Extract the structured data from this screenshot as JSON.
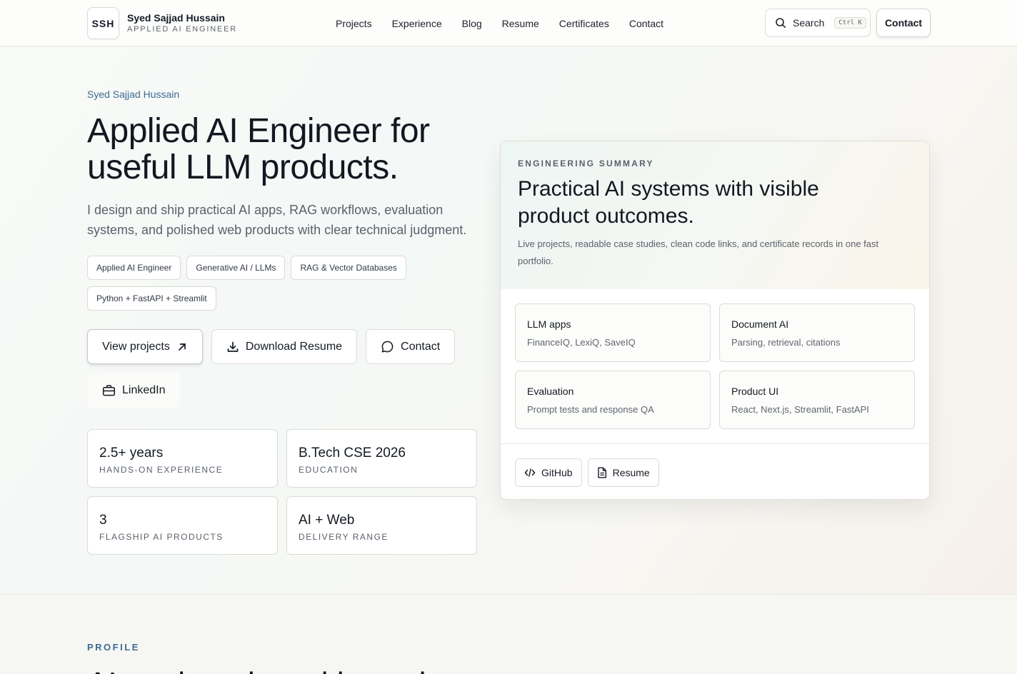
{
  "header": {
    "logo_text": "SSH",
    "name": "Syed Sajjad Hussain",
    "role": "APPLIED AI ENGINEER",
    "nav": [
      "Projects",
      "Experience",
      "Blog",
      "Resume",
      "Certificates",
      "Contact"
    ],
    "search_label": "Search",
    "search_shortcut": "Ctrl K",
    "contact_label": "Contact"
  },
  "hero": {
    "eyebrow": "Syed Sajjad Hussain",
    "title": "Applied AI Engineer for useful LLM products.",
    "subtitle": "I design and ship practical AI apps, RAG workflows, evaluation systems, and polished web products with clear technical judgment.",
    "chips": [
      "Applied AI Engineer",
      "Generative AI / LLMs",
      "RAG & Vector Databases",
      "Python + FastAPI + Streamlit"
    ],
    "actions": {
      "view_projects": "View projects",
      "download_resume": "Download Resume",
      "contact": "Contact",
      "linkedin": "LinkedIn"
    },
    "stats": [
      {
        "value": "2.5+ years",
        "label": "HANDS-ON EXPERIENCE"
      },
      {
        "value": "B.Tech CSE 2026",
        "label": "EDUCATION"
      },
      {
        "value": "3",
        "label": "FLAGSHIP AI PRODUCTS"
      },
      {
        "value": "AI + Web",
        "label": "DELIVERY RANGE"
      }
    ]
  },
  "summary": {
    "eyebrow": "ENGINEERING SUMMARY",
    "title": "Practical AI systems with visible product outcomes.",
    "description": "Live projects, readable case studies, clean code links, and certificate records in one fast portfolio.",
    "features": [
      {
        "title": "LLM apps",
        "desc": "FinanceIQ, LexiQ, SaveIQ"
      },
      {
        "title": "Document AI",
        "desc": "Parsing, retrieval, citations"
      },
      {
        "title": "Evaluation",
        "desc": "Prompt tests and response QA"
      },
      {
        "title": "Product UI",
        "desc": "React, Next.js, Streamlit, FastAPI"
      }
    ],
    "links": {
      "github": "GitHub",
      "resume": "Resume"
    }
  },
  "profile": {
    "eyebrow": "PROFILE",
    "heading": "AI engineering with product"
  }
}
